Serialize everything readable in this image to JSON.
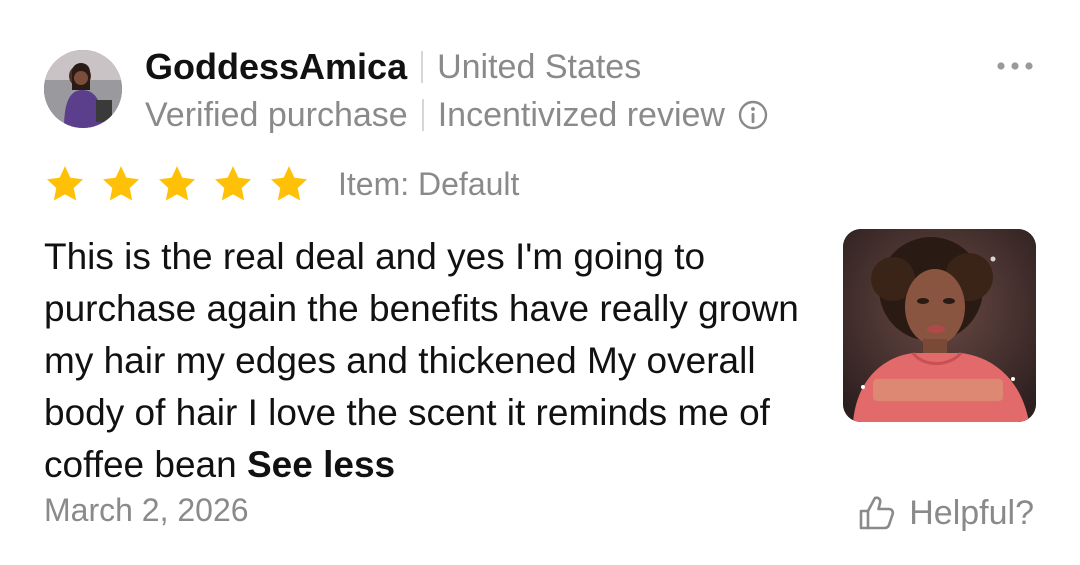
{
  "reviewer": {
    "username": "GoddessAmica",
    "country": "United States",
    "avatar_icon": "avatar-photo"
  },
  "badges": {
    "verified": "Verified purchase",
    "incentivized": "Incentivized review",
    "info_icon": "info-circle-icon"
  },
  "menu": {
    "icon": "more-horizontal-icon"
  },
  "rating": {
    "stars": 5,
    "max_stars": 5,
    "star_color": "#FFC107",
    "item_label": "Item: Default"
  },
  "review": {
    "text": "This is the real deal and yes I'm going to purchase again the benefits have really grown my hair my edges and thickened My overall body of hair I love the scent it reminds me of coffee bean",
    "see_less": "See less",
    "photo_icon": "review-photo"
  },
  "footer": {
    "date": "March 2, 2026",
    "helpful_label": "Helpful?",
    "helpful_icon": "thumbs-up-icon"
  },
  "colors": {
    "primary_text": "#111111",
    "secondary_text": "#8a8a8a",
    "separator": "#d6d6d6"
  }
}
